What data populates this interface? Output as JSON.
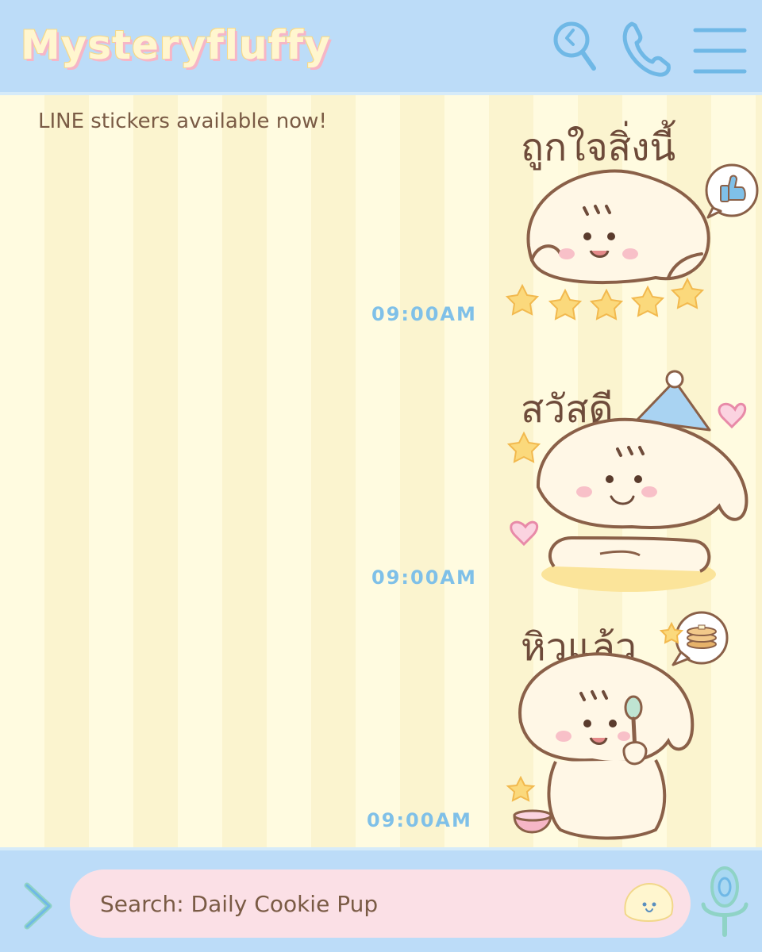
{
  "header": {
    "brand": "Mysteryfluffy",
    "icons": [
      "search-icon",
      "phone-icon",
      "menu-icon"
    ]
  },
  "chat": {
    "notice": "LINE stickers available now!",
    "messages": [
      {
        "caption": "ถูกใจสิ่งนี้",
        "time": "09:00AM",
        "sticker": "like-sticker"
      },
      {
        "caption": "สวัสดี",
        "time": "09:00AM",
        "sticker": "hello-sticker"
      },
      {
        "caption": "หิวแล้ว",
        "time": "09:00AM",
        "sticker": "hungry-sticker"
      }
    ]
  },
  "footer": {
    "search_text": "Search: Daily Cookie Pup",
    "icons": [
      "chevron-right-icon",
      "pup-face-icon",
      "microphone-icon"
    ]
  },
  "colors": {
    "header_bg": "#bcdcf8",
    "chat_bg": "#fdf8d6",
    "search_bg": "#fbe0e6",
    "icon_blue": "#6fb8e6",
    "text_brown": "#7a5b45",
    "time_blue": "#7fc0e8"
  }
}
